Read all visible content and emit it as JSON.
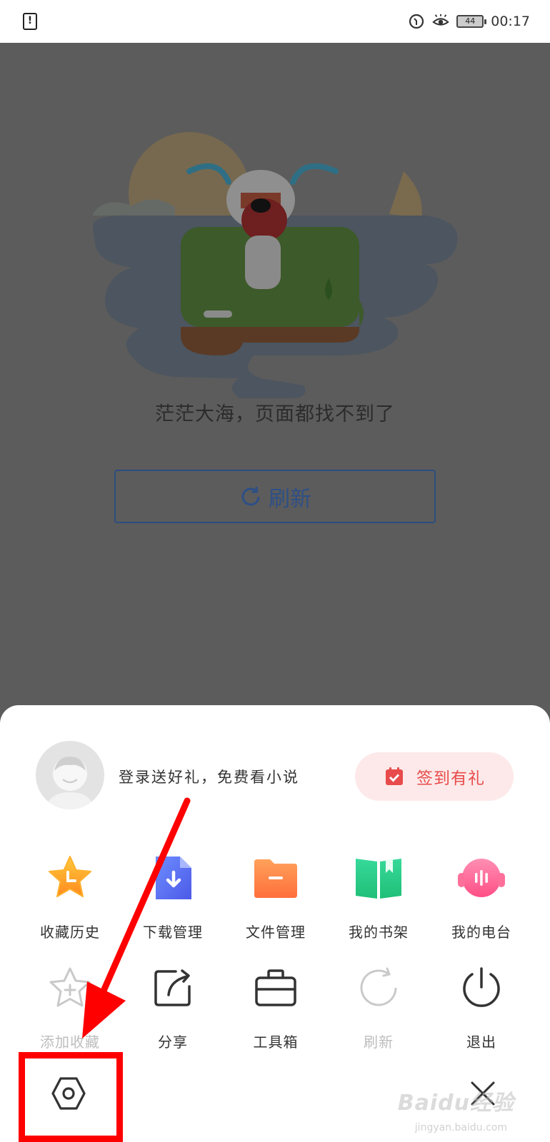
{
  "status_bar": {
    "battery": "44",
    "time": "00:17",
    "icons": [
      "alert-icon",
      "data-saver-icon",
      "eye-comfort-icon",
      "battery-icon"
    ]
  },
  "error_page": {
    "message": "茫茫大海，页面都找不到了",
    "refresh_label": "刷新"
  },
  "menu": {
    "login_prompt": "登录送好礼，免费看小说",
    "signin_label": "签到有礼",
    "row1": [
      {
        "label": "收藏历史",
        "icon": "star-clock-icon"
      },
      {
        "label": "下载管理",
        "icon": "download-file-icon"
      },
      {
        "label": "文件管理",
        "icon": "folder-icon"
      },
      {
        "label": "我的书架",
        "icon": "book-icon"
      },
      {
        "label": "我的电台",
        "icon": "radio-icon"
      }
    ],
    "row2": [
      {
        "label": "添加收藏",
        "icon": "add-star-icon"
      },
      {
        "label": "分享",
        "icon": "share-icon"
      },
      {
        "label": "工具箱",
        "icon": "toolbox-icon"
      },
      {
        "label": "刷新",
        "icon": "refresh-icon"
      },
      {
        "label": "退出",
        "icon": "power-icon"
      }
    ],
    "settings_icon": "settings-icon",
    "close_icon": "close-icon"
  },
  "watermark": {
    "text": "Baidu经验",
    "sub": "jingyan.baidu.com"
  },
  "colors": {
    "accent_red": "#e84b4b",
    "refresh_blue": "#2e4f86",
    "annotation_red": "#ff0000"
  }
}
